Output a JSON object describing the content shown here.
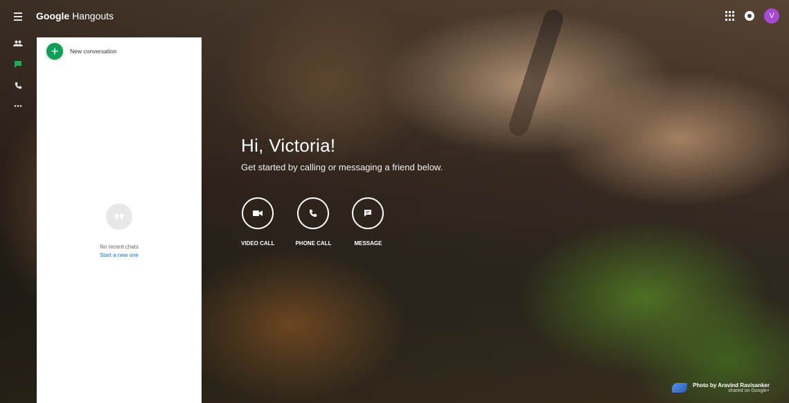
{
  "app": {
    "brand_bold": "Google",
    "brand_rest": " Hangouts"
  },
  "user": {
    "initial": "V"
  },
  "panel": {
    "new_conversation": "New conversation",
    "empty_text": "No recent chats",
    "empty_link": "Start a new one"
  },
  "main": {
    "greeting": "Hi, Victoria!",
    "subtitle": "Get started by calling or messaging a friend below.",
    "actions": [
      {
        "label": "VIDEO CALL",
        "icon": "video-camera-icon"
      },
      {
        "label": "PHONE CALL",
        "icon": "phone-icon"
      },
      {
        "label": "MESSAGE",
        "icon": "message-icon"
      }
    ]
  },
  "credit": {
    "by": "Photo by Aravind Ravisanker",
    "shared": "shared on Google+"
  },
  "colors": {
    "accent_green": "#0f9d58",
    "avatar": "#a64ad6",
    "link": "#1a73c8"
  }
}
